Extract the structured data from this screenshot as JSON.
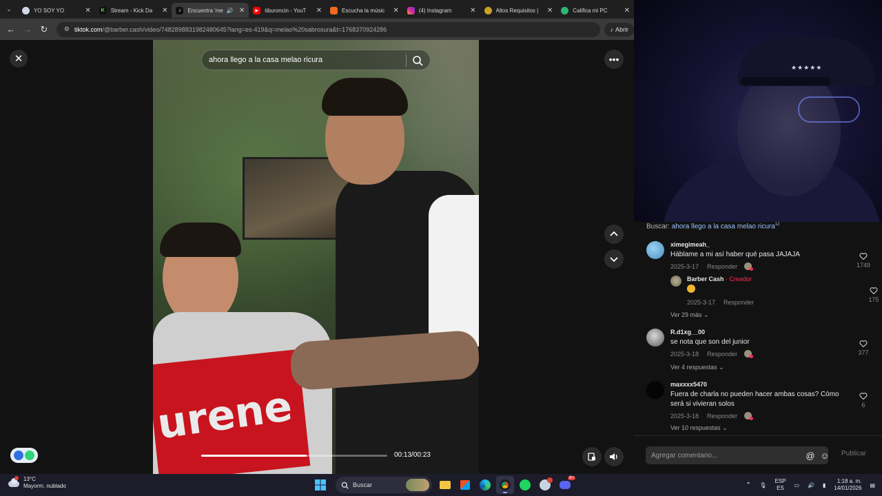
{
  "browser": {
    "tabs": [
      {
        "label": "YO SOY YO",
        "favicon": "yo-soy-yo-favicon",
        "color": "#cfd6e6",
        "active": false
      },
      {
        "label": "Stream - Kick Da",
        "favicon": "kick-favicon",
        "color": "#53fc18",
        "active": false
      },
      {
        "label": "Encuentra 'me",
        "favicon": "tiktok-favicon",
        "color": "#111111",
        "active": true
      },
      {
        "label": "tiburoncin - YouT",
        "favicon": "youtube-favicon",
        "color": "#ff0000",
        "active": false
      },
      {
        "label": "Escucha la músic",
        "favicon": "music-favicon",
        "color": "#f26b21",
        "active": false
      },
      {
        "label": "(4) Instagram",
        "favicon": "instagram-favicon",
        "color": "#d6249f",
        "active": false
      },
      {
        "label": "Altos Requisitos |",
        "favicon": "altos-favicon",
        "color": "#c9a227",
        "active": false
      },
      {
        "label": "Califica mi PC",
        "favicon": "califica-favicon",
        "color": "#2bb673",
        "active": false
      }
    ],
    "url_host": "tiktok.com",
    "url_path": "/@barber.cash/video/7482898831982480645?lang=es-419&q=melao%20sabrosura&t=1768370924286",
    "open_app_label": "Abrir"
  },
  "video": {
    "search_query": "ahora llego a la casa melao ricura",
    "time_current": "00:13",
    "time_total": "00:23",
    "progress": 0.565,
    "cape_text": "urene"
  },
  "comments": {
    "search_prefix": "Buscar:",
    "search_query": "ahora llego a la casa melao ricura",
    "search_suffix": "12",
    "reply_label": "Responder",
    "items": [
      {
        "user": "ximegimeah_",
        "text": "Háblame a mi así haber qué pasa JAJAJA",
        "date": "2025-3-17",
        "likes": "1749",
        "avatar_color": "#6aaee0"
      },
      {
        "user": "Barber Cash",
        "creator_tag": " · Creador",
        "text": "",
        "date": "2025-3-17",
        "likes": "175",
        "avatar_color": "#8f8a6e"
      },
      {
        "user": "R.d1xg__00",
        "text": "se nota que son del junior",
        "date": "2025-3-18",
        "likes": "377",
        "avatar_color": "#777777"
      },
      {
        "user": "maxxxx5470",
        "text": "Fuera de charla no pueden hacer ambas cosas? Cómo será si vivieran solos",
        "date": "2025-3-18",
        "likes": "6",
        "avatar_color": "#0a0a0a"
      }
    ],
    "more_1": "Ver 29 más",
    "more_2": "Ver 4 respuestas",
    "more_3": "Ver 10 respuestas",
    "input_placeholder": "Agregar comentario...",
    "publish_label": "Publicar"
  },
  "taskbar": {
    "temperature": "13°C",
    "weather": "Mayorm. nublado",
    "search_label": "Buscar",
    "lang_1": "ESP",
    "lang_2": "ES",
    "time": "1:18 a. m.",
    "date": "14/01/2026",
    "discord_badge": "9+"
  }
}
